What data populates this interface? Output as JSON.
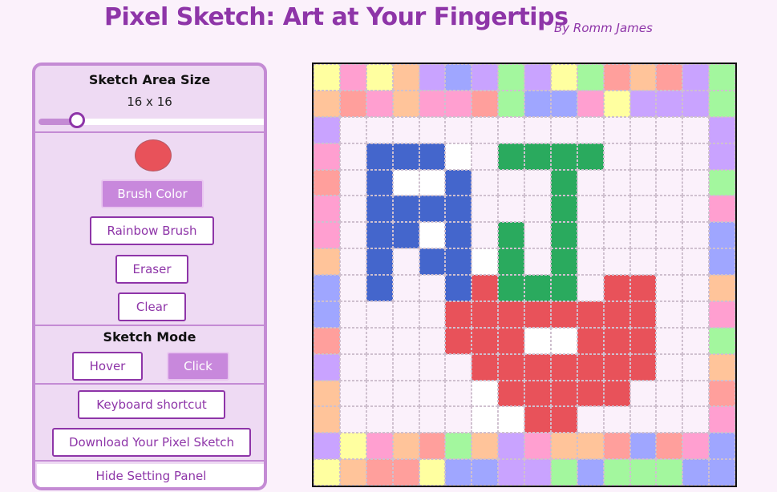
{
  "header": {
    "title": "Pixel Sketch: Art at Your Fingertips",
    "byline": "By Romm James"
  },
  "settings": {
    "size_heading": "Sketch Area Size",
    "size_label": "16 x 16",
    "slider_fraction": 0.17,
    "current_color": "#e8525a",
    "brush_color_label": "Brush Color",
    "rainbow_label": "Rainbow Brush",
    "eraser_label": "Eraser",
    "clear_label": "Clear",
    "mode_heading": "Sketch Mode",
    "hover_label": "Hover",
    "click_label": "Click",
    "active_mode": "click",
    "shortcut_label": "Keyboard shortcut",
    "download_label": "Download Your Pixel Sketch",
    "hide_label": "Hide Setting Panel"
  },
  "canvas": {
    "size": 16,
    "palette": {
      ".": "#fbf1fb",
      "w": "#ffffff",
      "y": "#ffffa0",
      "p": "#ff9fd0",
      "o": "#ffc49a",
      "l": "#c9a3ff",
      "b": "#9fa6ff",
      "g": "#a3f79e",
      "s": "#ff9f9c",
      "B": "#4466cc",
      "G": "#2aaa5e",
      "R": "#e8525a"
    },
    "rows": [
      "ypyolblglygsosl g",
      "ospoppsgbbpylllg",
      "l..............l",
      "p.BBBw.GGGG....l",
      "s.BwwB...G.....g",
      "p.BBBB...G.....p",
      "p.BBwB.G.G.....b",
      "o.B.BBwG.G.....b",
      "b.B..BRGGG.RR..o",
      "b....RRRRRRRR..p",
      "s....RRRwwRRR..g",
      "l.....RRRRRRR..o",
      "o.....wRRRRR...s",
      "o.....wwRR.....p",
      "lyposgolpoosbspb",
      "yossybbllgbgggbb"
    ]
  }
}
